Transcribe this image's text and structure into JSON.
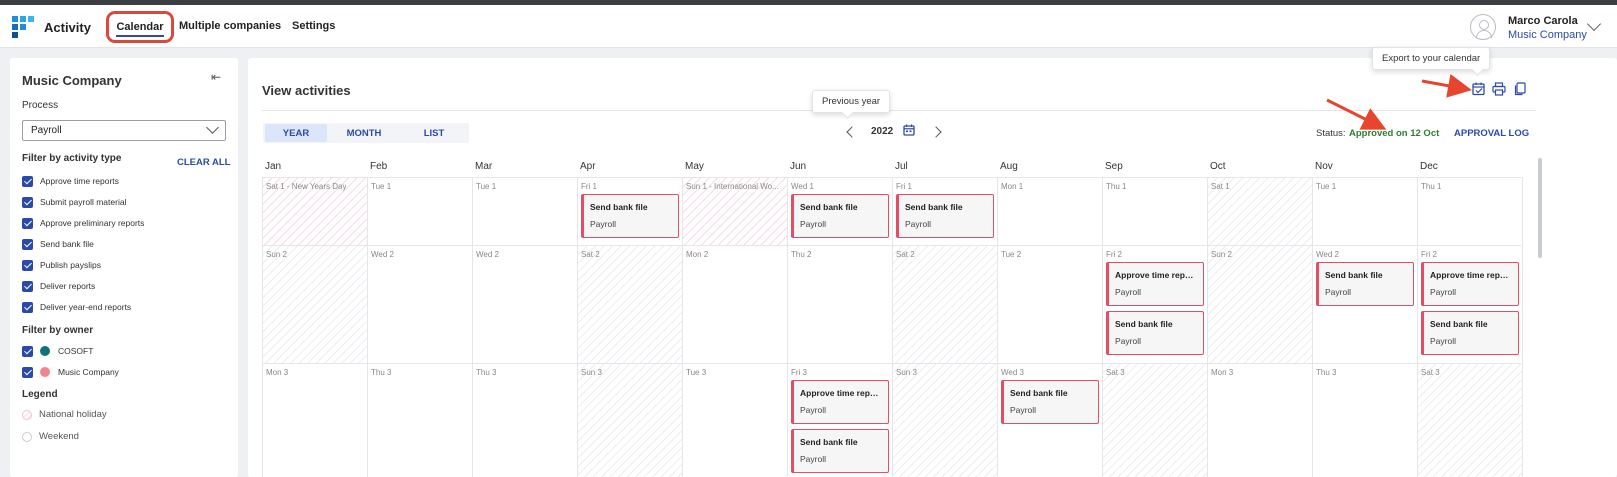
{
  "app": {
    "title": "Activity"
  },
  "nav": {
    "tabs": [
      {
        "label": "Calendar"
      },
      {
        "label": "Multiple companies"
      },
      {
        "label": "Settings"
      }
    ]
  },
  "user": {
    "name": "Marco Carola",
    "company": "Music Company"
  },
  "sidebar": {
    "title": "Music Company",
    "process_label": "Process",
    "process_value": "Payroll",
    "filter_activity_title": "Filter by activity type",
    "clear_all": "CLEAR ALL",
    "activity_types": [
      "Approve time reports",
      "Submit payroll material",
      "Approve preliminary reports",
      "Send bank file",
      "Publish payslips",
      "Deliver reports",
      "Deliver year-end reports"
    ],
    "filter_owner_title": "Filter by owner",
    "owners": [
      {
        "label": "COSOFT",
        "color": "#12707a"
      },
      {
        "label": "Music Company",
        "color": "#f2848f"
      }
    ],
    "legend_title": "Legend",
    "legend": [
      "National holiday",
      "Weekend"
    ]
  },
  "main": {
    "title": "View activities",
    "views": [
      "YEAR",
      "MONTH",
      "LIST"
    ],
    "year": "2022",
    "status_label": "Status:",
    "status_value": "Approved on 12 Oct",
    "approval_log": "APPROVAL LOG",
    "tooltip_prev": "Previous year",
    "tooltip_export": "Export to your calendar"
  },
  "calendar": {
    "months": [
      "Jan",
      "Feb",
      "Mar",
      "Apr",
      "May",
      "Jun",
      "Jul",
      "Aug",
      "Sep",
      "Oct",
      "Nov",
      "Dec"
    ],
    "days": [
      [
        "Sat 1 - New Years Day",
        "Tue 1",
        "Tue 1",
        "Fri 1",
        "Sun 1 - International Wo...",
        "Wed 1",
        "Fri 1",
        "Mon 1",
        "Thu 1",
        "Sat 1",
        "Tue 1",
        "Thu 1"
      ],
      [
        "Sun 2",
        "Wed 2",
        "Wed 2",
        "Sat 2",
        "Mon 2",
        "Thu 2",
        "Sat 2",
        "Tue 2",
        "Fri 2",
        "Sun 2",
        "Wed 2",
        "Fri 2"
      ],
      [
        "Mon 3",
        "Thu 3",
        "Thu 3",
        "Sun 3",
        "Tue 3",
        "Fri 3",
        "Sun 3",
        "Wed 3",
        "Sat 3",
        "Mon 3",
        "Thu 3",
        "Sat 3"
      ]
    ],
    "events": [
      {
        "row": 0,
        "col": 3,
        "slot": 0,
        "title": "Send bank file",
        "sub": "Payroll"
      },
      {
        "row": 0,
        "col": 5,
        "slot": 0,
        "title": "Send bank file",
        "sub": "Payroll"
      },
      {
        "row": 0,
        "col": 6,
        "slot": 0,
        "title": "Send bank file",
        "sub": "Payroll"
      },
      {
        "row": 1,
        "col": 8,
        "slot": 0,
        "title": "Approve time repo...",
        "sub": "Payroll"
      },
      {
        "row": 1,
        "col": 8,
        "slot": 1,
        "title": "Send bank file",
        "sub": "Payroll"
      },
      {
        "row": 1,
        "col": 10,
        "slot": 0,
        "title": "Send bank file",
        "sub": "Payroll"
      },
      {
        "row": 1,
        "col": 11,
        "slot": 0,
        "title": "Approve time repo...",
        "sub": "Payroll"
      },
      {
        "row": 1,
        "col": 11,
        "slot": 1,
        "title": "Send bank file",
        "sub": "Payroll"
      },
      {
        "row": 2,
        "col": 5,
        "slot": 0,
        "title": "Approve time repo...",
        "sub": "Payroll"
      },
      {
        "row": 2,
        "col": 5,
        "slot": 1,
        "title": "Send bank file",
        "sub": "Payroll"
      },
      {
        "row": 2,
        "col": 7,
        "slot": 0,
        "title": "Send bank file",
        "sub": "Payroll"
      }
    ]
  }
}
